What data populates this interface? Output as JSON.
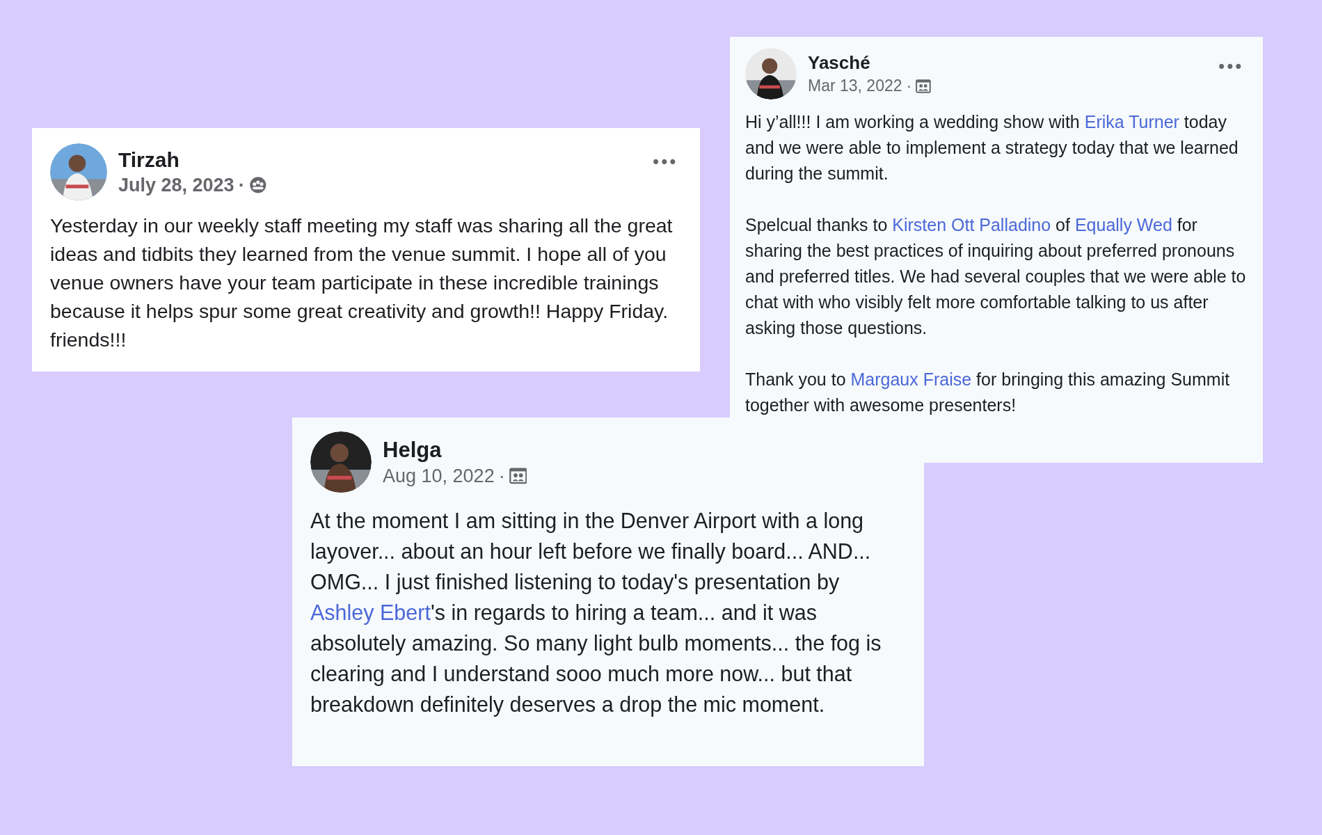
{
  "posts": [
    {
      "author": "Yasché",
      "date": "Mar 13, 2022",
      "separator": "·",
      "audience": {
        "kind": "group"
      },
      "menu": "•••",
      "paragraphs": [
        [
          {
            "kind": "text",
            "text": "Hi y’all!!! I am working a wedding show with "
          },
          {
            "kind": "link",
            "text": "Erika Turner"
          },
          {
            "kind": "text",
            "text": " today and we were able to implement a strategy today that we learned during the summit."
          }
        ],
        [
          {
            "kind": "text",
            "text": "Spelcual thanks to "
          },
          {
            "kind": "link",
            "text": "Kirsten Ott Palladino"
          },
          {
            "kind": "text",
            "text": " of "
          },
          {
            "kind": "link",
            "text": "Equally Wed"
          },
          {
            "kind": "text",
            "text": " for sharing the best practices of inquiring about preferred pronouns and preferred titles. We had several couples that we were able to chat with who visibly felt more comfortable talking to us after asking those questions."
          }
        ],
        [
          {
            "kind": "text",
            "text": "Thank you to "
          },
          {
            "kind": "link",
            "text": "Margaux Fraise"
          },
          {
            "kind": "text",
            "text": " for bringing this amazing Summit together with awesome presenters!"
          }
        ]
      ]
    },
    {
      "author": "Tirzah",
      "date": "July 28, 2023",
      "separator": "·",
      "audience": {
        "kind": "friends"
      },
      "menu": "•••",
      "paragraphs": [
        [
          {
            "kind": "text",
            "text": "Yesterday in our weekly staff meeting my staff was sharing all the great ideas and tidbits they learned from the venue summit. I hope all of you venue owners have your team participate in these incredible trainings because it helps spur some great creativity and growth!! Happy Friday. friends!!!"
          }
        ]
      ]
    },
    {
      "author": "Helga",
      "date": "Aug 10, 2022",
      "separator": "·",
      "audience": {
        "kind": "group"
      },
      "paragraphs": [
        [
          {
            "kind": "text",
            "text": "At the moment I am sitting in the Denver Airport with a long layover... about an hour left before we finally board... AND... OMG... I just finished listening to today's presentation by "
          },
          {
            "kind": "link",
            "text": "Ashley Ebert"
          },
          {
            "kind": "text",
            "text": "'s in regards to hiring a team... and it was absolutely amazing. So many light bulb moments... the fog is clearing and  I understand sooo much more now... but that breakdown definitely deserves a drop the mic moment."
          }
        ]
      ]
    }
  ]
}
